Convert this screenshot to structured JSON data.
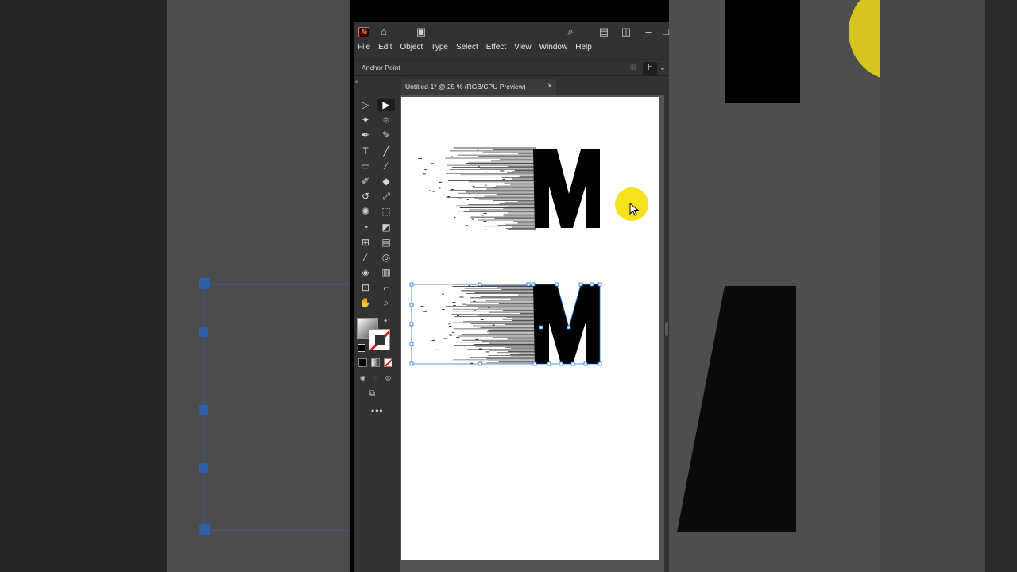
{
  "app": {
    "logo": "Ai",
    "icons": [
      "home-icon",
      "arrange-documents-icon",
      "search-icon",
      "workspace-icon",
      "panel-icon",
      "minimize-icon",
      "maximize-icon"
    ]
  },
  "menu": [
    "File",
    "Edit",
    "Object",
    "Type",
    "Select",
    "Effect",
    "View",
    "Window",
    "Help"
  ],
  "control_bar": {
    "label": "Anchor Point"
  },
  "document": {
    "tab_title": "Untitled-1* @ 25 % (RGB/CPU Preview)",
    "close_glyph": "×"
  },
  "tools": [
    "selection-tool",
    "direct-selection-tool",
    "magic-wand-tool",
    "lasso-tool",
    "pen-tool",
    "curvature-tool",
    "type-tool",
    "line-segment-tool",
    "rectangle-tool",
    "paintbrush-tool",
    "shaper-tool",
    "eraser-tool",
    "rotate-tool",
    "scale-tool",
    "puppet-warp-tool",
    "free-transform-tool",
    "shape-builder-tool",
    "perspective-grid-tool",
    "mesh-tool",
    "gradient-tool",
    "eyedropper-tool",
    "blend-tool",
    "symbol-sprayer-tool",
    "column-graph-tool",
    "artboard-tool",
    "slice-tool",
    "hand-tool",
    "zoom-tool"
  ],
  "artwork": {
    "letter": "M",
    "colors": {
      "ink": "#000000",
      "selection": "#1473e6",
      "cursor_highlight": "#f5e21a"
    }
  }
}
